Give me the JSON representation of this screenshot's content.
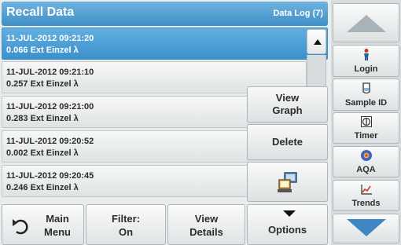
{
  "header": {
    "title": "Recall Data",
    "count": "Data Log (7)"
  },
  "list": {
    "rows": [
      {
        "datetime": "11-JUL-2012  09:21:20",
        "reading": "0.066  Ext  Einzel λ",
        "selected": true
      },
      {
        "datetime": "11-JUL-2012  09:21:10",
        "reading": "0.257  Ext  Einzel λ"
      },
      {
        "datetime": "11-JUL-2012  09:21:00",
        "reading": "0.283  Ext  Einzel λ"
      },
      {
        "datetime": "11-JUL-2012  09:20:52",
        "reading": "0.002  Ext  Einzel λ"
      },
      {
        "datetime": "11-JUL-2012  09:20:45",
        "reading": "0.246  Ext  Einzel λ"
      }
    ]
  },
  "popup": {
    "view_graph_1": "View",
    "view_graph_2": "Graph",
    "delete": "Delete"
  },
  "bottom": {
    "main_menu_1": "Main",
    "main_menu_2": "Menu",
    "filter_1": "Filter:",
    "filter_2": "On",
    "view_details_1": "View",
    "view_details_2": "Details",
    "options": "Options"
  },
  "sidebar": {
    "login": "Login",
    "sample_id": "Sample ID",
    "timer": "Timer",
    "aqa": "AQA",
    "trends": "Trends"
  },
  "colors": {
    "accent": "#3f8fc7",
    "selected_row": "#4a9bd3"
  }
}
